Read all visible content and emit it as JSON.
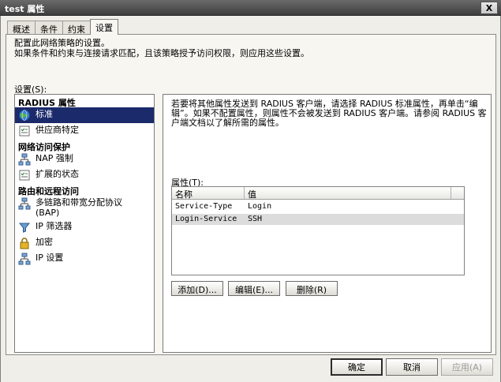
{
  "window": {
    "title": "test 属性",
    "close_label": "X"
  },
  "tabs": [
    {
      "label": "概述"
    },
    {
      "label": "条件"
    },
    {
      "label": "约束"
    },
    {
      "label": "设置"
    }
  ],
  "intro": {
    "line1": "配置此网络策略的设置。",
    "line2": "如果条件和约束与连接请求匹配，且该策略授予访问权限，则应用这些设置。"
  },
  "settings_label": "设置(S):",
  "nav": {
    "sections": [
      {
        "header": "RADIUS 属性",
        "items": [
          {
            "label": "标准",
            "icon": "globe-icon"
          },
          {
            "label": "供应商特定",
            "icon": "checklist-icon"
          }
        ]
      },
      {
        "header": "网络访问保护",
        "items": [
          {
            "label": "NAP 强制",
            "icon": "network-icon"
          },
          {
            "label": "扩展的状态",
            "icon": "checklist-icon"
          }
        ]
      },
      {
        "header": "路由和远程访问",
        "items": [
          {
            "label": "多链路和带宽分配协议",
            "label2": "(BAP)",
            "icon": "network-icon"
          },
          {
            "label": "IP 筛选器",
            "icon": "filter-icon"
          },
          {
            "label": "加密",
            "icon": "lock-icon"
          },
          {
            "label": "IP 设置",
            "icon": "network-icon"
          }
        ]
      }
    ]
  },
  "right": {
    "description": "若要将其他属性发送到 RADIUS 客户端，请选择 RADIUS 标准属性，再单击“编辑”。如果不配置属性，则属性不会被发送到 RADIUS 客户端。请参阅 RADIUS 客户端文档以了解所需的属性。",
    "attributes_label": "属性(T):",
    "columns": [
      "名称",
      "值"
    ],
    "rows": [
      {
        "name": "Service-Type",
        "value": "Login"
      },
      {
        "name": "Login-Service",
        "value": "SSH"
      }
    ],
    "buttons": {
      "add": "添加(D)...",
      "edit": "编辑(E)...",
      "remove": "删除(R)"
    }
  },
  "footer": {
    "ok": "确定",
    "cancel": "取消",
    "apply": "应用(A)"
  },
  "colors": {
    "selection": "#1b2a6b",
    "row_highlight": "#dcdcdc",
    "titlebar": "#4a4a4a"
  }
}
